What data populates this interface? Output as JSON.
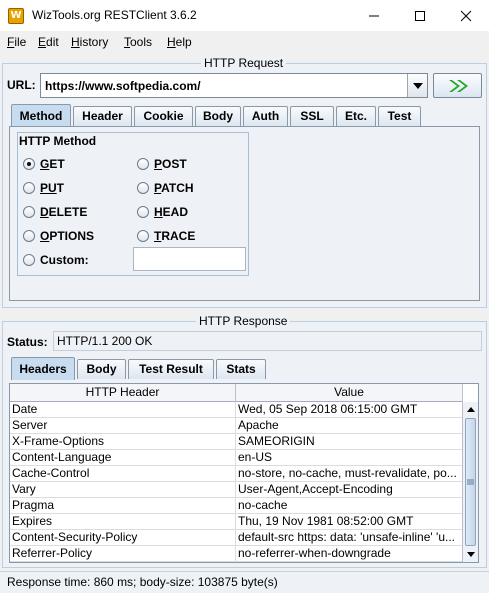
{
  "window": {
    "title": "WizTools.org RESTClient 3.6.2",
    "icon": "wiztools-logo-icon"
  },
  "menu": [
    {
      "first": "F",
      "rest": "ile"
    },
    {
      "first": "E",
      "rest": "dit"
    },
    {
      "first": "H",
      "rest": "istory"
    },
    {
      "first": "T",
      "rest": "ools"
    },
    {
      "first": "H",
      "rest": "elp"
    }
  ],
  "request": {
    "title": "HTTP Request",
    "url_label": "URL:",
    "url_value": "https://www.softpedia.com/",
    "go_icon": "double-chevron-right-icon",
    "tabs": [
      "Method",
      "Header",
      "Cookie",
      "Body",
      "Auth",
      "SSL",
      "Etc.",
      "Test"
    ],
    "active_tab": "Method",
    "method_group_title": "HTTP Method",
    "methods": [
      {
        "first": "G",
        "rest": "ET",
        "selected": true
      },
      {
        "first": "P",
        "rest": "OST",
        "selected": false
      },
      {
        "first": "PU",
        "rest": "T",
        "selected": false
      },
      {
        "first": "P",
        "rest": "ATCH",
        "selected": false
      },
      {
        "first": "D",
        "rest": "ELETE",
        "selected": false
      },
      {
        "first": "H",
        "rest": "EAD",
        "selected": false
      },
      {
        "first": "O",
        "rest": "PTIONS",
        "selected": false
      },
      {
        "first": "T",
        "rest": "RACE",
        "selected": false
      }
    ],
    "custom_label": "Custom:",
    "custom_value": ""
  },
  "response": {
    "title": "HTTP Response",
    "status_label": "Status:",
    "status_value": "HTTP/1.1 200 OK",
    "tabs": [
      "Headers",
      "Body",
      "Test Result",
      "Stats"
    ],
    "active_tab": "Headers",
    "columns": [
      "HTTP Header",
      "Value"
    ],
    "rows": [
      [
        "Date",
        "Wed, 05 Sep 2018 06:15:00 GMT"
      ],
      [
        "Server",
        "Apache"
      ],
      [
        "X-Frame-Options",
        "SAMEORIGIN"
      ],
      [
        "Content-Language",
        "en-US"
      ],
      [
        "Cache-Control",
        "no-store, no-cache, must-revalidate, po..."
      ],
      [
        "Vary",
        "User-Agent,Accept-Encoding"
      ],
      [
        "Pragma",
        "no-cache"
      ],
      [
        "Expires",
        "Thu, 19 Nov 1981 08:52:00 GMT"
      ],
      [
        "Content-Security-Policy",
        "default-src https: data: 'unsafe-inline' 'u..."
      ],
      [
        "Referrer-Policy",
        "no-referrer-when-downgrade"
      ]
    ]
  },
  "statusbar": {
    "text": "Response time: 860 ms; body-size: 103875 byte(s)"
  }
}
